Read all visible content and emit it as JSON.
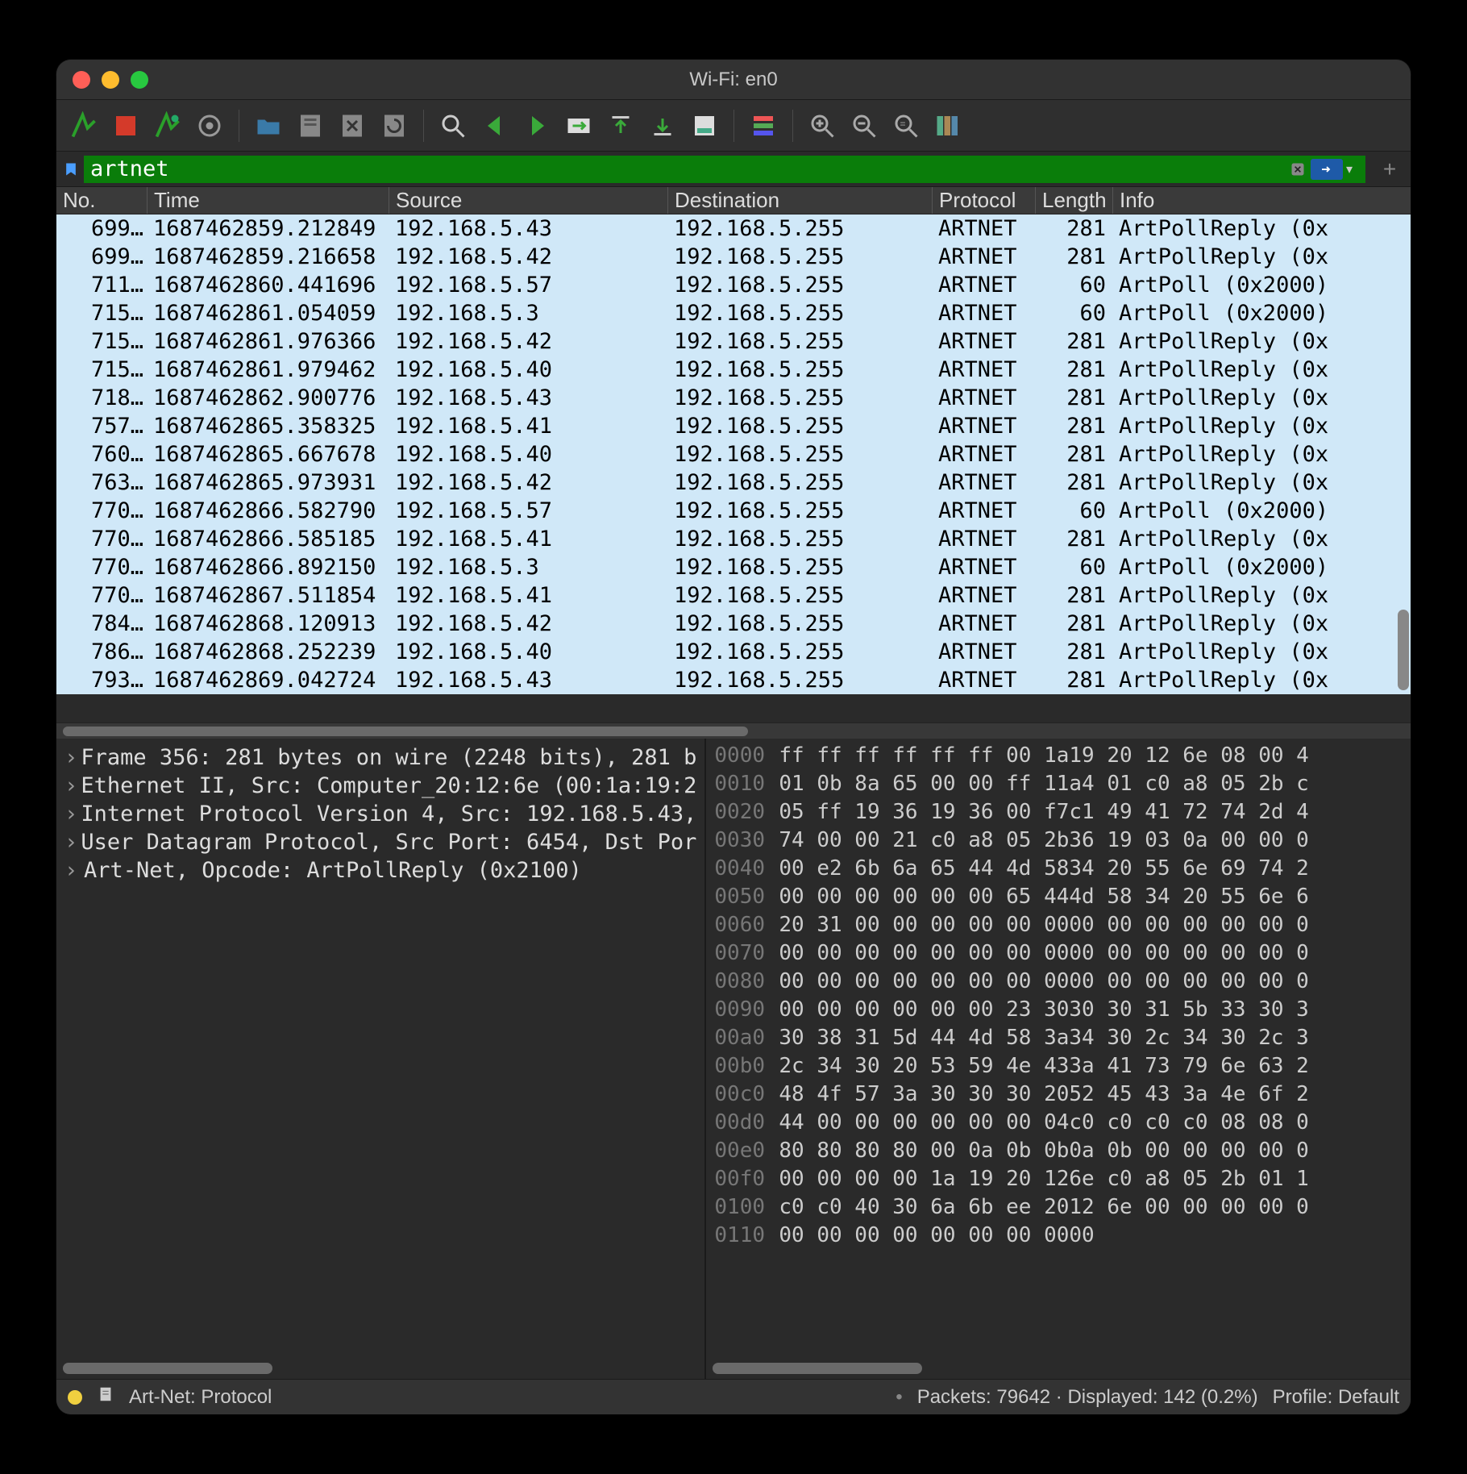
{
  "title": "Wi-Fi: en0",
  "filter": {
    "value": "artnet"
  },
  "columns": {
    "no": "No.",
    "time": "Time",
    "src": "Source",
    "dst": "Destination",
    "proto": "Protocol",
    "len": "Length",
    "info": "Info"
  },
  "packets": [
    {
      "no": "699…",
      "time": "1687462859.212849",
      "src": "192.168.5.43",
      "dst": "192.168.5.255",
      "proto": "ARTNET",
      "len": "281",
      "info": "ArtPollReply (0x"
    },
    {
      "no": "699…",
      "time": "1687462859.216658",
      "src": "192.168.5.42",
      "dst": "192.168.5.255",
      "proto": "ARTNET",
      "len": "281",
      "info": "ArtPollReply (0x"
    },
    {
      "no": "711…",
      "time": "1687462860.441696",
      "src": "192.168.5.57",
      "dst": "192.168.5.255",
      "proto": "ARTNET",
      "len": "60",
      "info": "ArtPoll (0x2000)"
    },
    {
      "no": "715…",
      "time": "1687462861.054059",
      "src": "192.168.5.3",
      "dst": "192.168.5.255",
      "proto": "ARTNET",
      "len": "60",
      "info": "ArtPoll (0x2000)"
    },
    {
      "no": "715…",
      "time": "1687462861.976366",
      "src": "192.168.5.42",
      "dst": "192.168.5.255",
      "proto": "ARTNET",
      "len": "281",
      "info": "ArtPollReply (0x"
    },
    {
      "no": "715…",
      "time": "1687462861.979462",
      "src": "192.168.5.40",
      "dst": "192.168.5.255",
      "proto": "ARTNET",
      "len": "281",
      "info": "ArtPollReply (0x"
    },
    {
      "no": "718…",
      "time": "1687462862.900776",
      "src": "192.168.5.43",
      "dst": "192.168.5.255",
      "proto": "ARTNET",
      "len": "281",
      "info": "ArtPollReply (0x"
    },
    {
      "no": "757…",
      "time": "1687462865.358325",
      "src": "192.168.5.41",
      "dst": "192.168.5.255",
      "proto": "ARTNET",
      "len": "281",
      "info": "ArtPollReply (0x"
    },
    {
      "no": "760…",
      "time": "1687462865.667678",
      "src": "192.168.5.40",
      "dst": "192.168.5.255",
      "proto": "ARTNET",
      "len": "281",
      "info": "ArtPollReply (0x"
    },
    {
      "no": "763…",
      "time": "1687462865.973931",
      "src": "192.168.5.42",
      "dst": "192.168.5.255",
      "proto": "ARTNET",
      "len": "281",
      "info": "ArtPollReply (0x"
    },
    {
      "no": "770…",
      "time": "1687462866.582790",
      "src": "192.168.5.57",
      "dst": "192.168.5.255",
      "proto": "ARTNET",
      "len": "60",
      "info": "ArtPoll (0x2000)"
    },
    {
      "no": "770…",
      "time": "1687462866.585185",
      "src": "192.168.5.41",
      "dst": "192.168.5.255",
      "proto": "ARTNET",
      "len": "281",
      "info": "ArtPollReply (0x"
    },
    {
      "no": "770…",
      "time": "1687462866.892150",
      "src": "192.168.5.3",
      "dst": "192.168.5.255",
      "proto": "ARTNET",
      "len": "60",
      "info": "ArtPoll (0x2000)"
    },
    {
      "no": "770…",
      "time": "1687462867.511854",
      "src": "192.168.5.41",
      "dst": "192.168.5.255",
      "proto": "ARTNET",
      "len": "281",
      "info": "ArtPollReply (0x"
    },
    {
      "no": "784…",
      "time": "1687462868.120913",
      "src": "192.168.5.42",
      "dst": "192.168.5.255",
      "proto": "ARTNET",
      "len": "281",
      "info": "ArtPollReply (0x"
    },
    {
      "no": "786…",
      "time": "1687462868.252239",
      "src": "192.168.5.40",
      "dst": "192.168.5.255",
      "proto": "ARTNET",
      "len": "281",
      "info": "ArtPollReply (0x"
    },
    {
      "no": "793…",
      "time": "1687462869.042724",
      "src": "192.168.5.43",
      "dst": "192.168.5.255",
      "proto": "ARTNET",
      "len": "281",
      "info": "ArtPollReply (0x"
    }
  ],
  "details": [
    "Frame 356: 281 bytes on wire (2248 bits), 281 b",
    "Ethernet II, Src: Computer_20:12:6e (00:1a:19:2",
    "Internet Protocol Version 4, Src: 192.168.5.43,",
    "User Datagram Protocol, Src Port: 6454, Dst Por",
    "Art-Net, Opcode: ArtPollReply (0x2100)"
  ],
  "hex": [
    {
      "o": "0000",
      "a": "ff ff ff ff ff ff 00 1a",
      "b": "19 20 12 6e 08 00 4"
    },
    {
      "o": "0010",
      "a": "01 0b 8a 65 00 00 ff 11",
      "b": "a4 01 c0 a8 05 2b c"
    },
    {
      "o": "0020",
      "a": "05 ff 19 36 19 36 00 f7",
      "b": "c1 49 41 72 74 2d 4"
    },
    {
      "o": "0030",
      "a": "74 00 00 21 c0 a8 05 2b",
      "b": "36 19 03 0a 00 00 0"
    },
    {
      "o": "0040",
      "a": "00 e2 6b 6a 65 44 4d 58",
      "b": "34 20 55 6e 69 74 2"
    },
    {
      "o": "0050",
      "a": "00 00 00 00 00 00 65 44",
      "b": "4d 58 34 20 55 6e 6"
    },
    {
      "o": "0060",
      "a": "20 31 00 00 00 00 00 00",
      "b": "00 00 00 00 00 00 0"
    },
    {
      "o": "0070",
      "a": "00 00 00 00 00 00 00 00",
      "b": "00 00 00 00 00 00 0"
    },
    {
      "o": "0080",
      "a": "00 00 00 00 00 00 00 00",
      "b": "00 00 00 00 00 00 0"
    },
    {
      "o": "0090",
      "a": "00 00 00 00 00 00 23 30",
      "b": "30 30 31 5b 33 30 3"
    },
    {
      "o": "00a0",
      "a": "30 38 31 5d 44 4d 58 3a",
      "b": "34 30 2c 34 30 2c 3"
    },
    {
      "o": "00b0",
      "a": "2c 34 30 20 53 59 4e 43",
      "b": "3a 41 73 79 6e 63 2"
    },
    {
      "o": "00c0",
      "a": "48 4f 57 3a 30 30 30 20",
      "b": "52 45 43 3a 4e 6f 2"
    },
    {
      "o": "00d0",
      "a": "44 00 00 00 00 00 00 04",
      "b": "c0 c0 c0 c0 08 08 0"
    },
    {
      "o": "00e0",
      "a": "80 80 80 80 00 0a 0b 0b",
      "b": "0a 0b 00 00 00 00 0"
    },
    {
      "o": "00f0",
      "a": "00 00 00 00 1a 19 20 12",
      "b": "6e c0 a8 05 2b 01 1"
    },
    {
      "o": "0100",
      "a": "c0 c0 40 30 6a 6b ee 20",
      "b": "12 6e 00 00 00 00 0"
    },
    {
      "o": "0110",
      "a": "00 00 00 00 00 00 00 00",
      "b": "00"
    }
  ],
  "status": {
    "field": "Art-Net: Protocol",
    "packets": "Packets: 79642 · Displayed: 142 (0.2%)",
    "profile": "Profile: Default"
  }
}
